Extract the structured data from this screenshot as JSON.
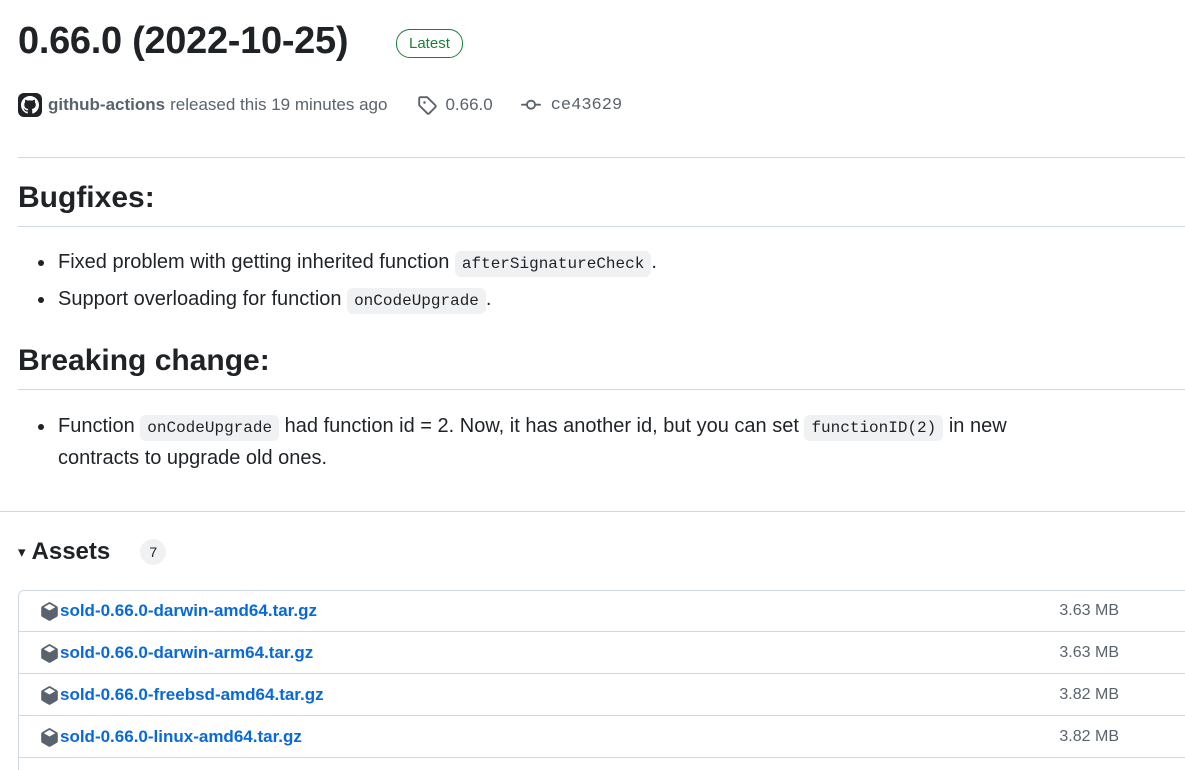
{
  "release": {
    "title": "0.66.0 (2022-10-25)",
    "badge": "Latest",
    "author": "github-actions",
    "released_text": "released this 19 minutes ago",
    "tag": "0.66.0",
    "commit": "ce43629"
  },
  "sections": {
    "bugfixes": {
      "heading": "Bugfixes:",
      "items": [
        {
          "before": "Fixed problem with getting inherited function ",
          "code": "afterSignatureCheck",
          "after": "."
        },
        {
          "before": "Support overloading for function ",
          "code": "onCodeUpgrade",
          "after": "."
        }
      ]
    },
    "breaking": {
      "heading": "Breaking change:",
      "items": [
        {
          "before": "Function ",
          "code1": "onCodeUpgrade",
          "middle": " had function id = 2. Now, it has another id, but you can set ",
          "code2": "functionID(2)",
          "after1": " in new",
          "after2": "contracts to upgrade old ones."
        }
      ]
    }
  },
  "assets": {
    "caret": "▾",
    "title": "Assets",
    "count": "7",
    "items": [
      {
        "name": "sold-0.66.0-darwin-amd64.tar.gz",
        "size": "3.63 MB"
      },
      {
        "name": "sold-0.66.0-darwin-arm64.tar.gz",
        "size": "3.63 MB"
      },
      {
        "name": "sold-0.66.0-freebsd-amd64.tar.gz",
        "size": "3.82 MB"
      },
      {
        "name": "sold-0.66.0-linux-amd64.tar.gz",
        "size": "3.82 MB"
      }
    ]
  },
  "icons": {
    "avatar": "github-mark-icon",
    "tag": "tag-icon",
    "commit": "git-commit-icon",
    "asset": "package-icon"
  },
  "colors": {
    "link": "#0969da",
    "latest": "#1a7f37",
    "muted": "#59636e",
    "border": "#d1d9e0"
  }
}
